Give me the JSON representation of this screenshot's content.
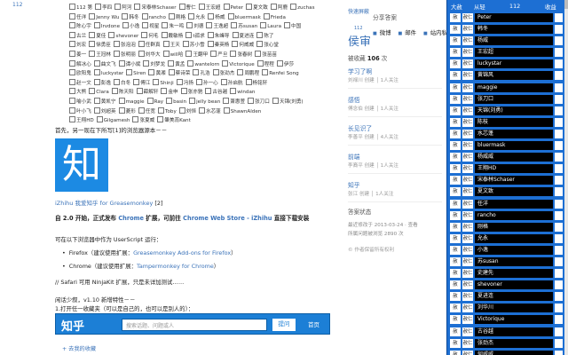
{
  "gutter": {
    "num": "112"
  },
  "checkbox_rows": [
    [
      {
        "l": "112 第",
        "c": false
      },
      {
        "l": "李四",
        "c": false
      },
      {
        "l": "阿河",
        "c": false
      },
      {
        "l": "宋泰林Schaser",
        "c": false
      },
      {
        "l": "曹仁",
        "c": false
      },
      {
        "l": "王宏超",
        "c": false
      },
      {
        "l": "Peter",
        "c": false
      },
      {
        "l": "夏文致",
        "c": false
      },
      {
        "l": "阿鹿",
        "c": false
      },
      {
        "l": "zuchas",
        "c": false
      }
    ],
    [
      {
        "l": "任洋",
        "c": false
      },
      {
        "l": "Jenny Wu",
        "c": false
      },
      {
        "l": "韩冬",
        "c": false
      },
      {
        "l": "rancho",
        "c": false
      },
      {
        "l": "刚格",
        "c": false
      },
      {
        "l": "允永",
        "c": false
      },
      {
        "l": "杨威",
        "c": false
      },
      {
        "l": "bluermask",
        "c": false
      },
      {
        "l": "Frieda",
        "c": false
      }
    ],
    [
      {
        "l": "陈心宇",
        "c": false
      },
      {
        "l": "Irvdone",
        "c": false
      },
      {
        "l": "小逸",
        "c": false
      },
      {
        "l": "视星",
        "c": false
      },
      {
        "l": "朱一鸣",
        "c": false
      },
      {
        "l": "刘德",
        "c": false
      },
      {
        "l": "王逸超",
        "c": false
      },
      {
        "l": "苏susan",
        "c": false
      },
      {
        "l": "Laura",
        "c": false
      },
      {
        "l": "中国",
        "c": false
      }
    ],
    [
      {
        "l": "古兰",
        "c": false
      },
      {
        "l": "夏佳",
        "c": false
      },
      {
        "l": "shevoner",
        "c": false
      },
      {
        "l": "何毛",
        "c": false
      },
      {
        "l": "戴敏杨",
        "c": false
      },
      {
        "l": "t孤求",
        "c": false
      },
      {
        "l": "朱峰导",
        "c": false
      },
      {
        "l": "夏进连",
        "c": false
      },
      {
        "l": "陈了",
        "c": false
      }
    ],
    [
      {
        "l": "刘宏",
        "c": false
      },
      {
        "l": "徐勇臣",
        "c": false
      },
      {
        "l": "张泡泡",
        "c": false
      },
      {
        "l": "任群真",
        "c": false
      },
      {
        "l": "王天",
        "c": false
      },
      {
        "l": "苏小雪",
        "c": false
      },
      {
        "l": "秦英杨",
        "c": false
      },
      {
        "l": "何威威",
        "c": false
      },
      {
        "l": "张心堂",
        "c": false
      }
    ],
    [
      {
        "l": "姜一",
        "c": false
      },
      {
        "l": "王冠林",
        "c": false
      },
      {
        "l": "张明丽",
        "c": false
      },
      {
        "l": "刘华大",
        "c": false
      },
      {
        "l": "will哈",
        "c": false
      },
      {
        "l": "王翻甲",
        "c": false
      },
      {
        "l": "严旦",
        "c": false
      },
      {
        "l": "张春树",
        "c": false
      },
      {
        "l": "张苗苗",
        "c": false
      }
    ],
    [
      {
        "l": "解冰心",
        "c": false
      },
      {
        "l": "曲文飞",
        "c": false
      },
      {
        "l": "谭小斌",
        "c": false
      },
      {
        "l": "刘梦龙",
        "c": false
      },
      {
        "l": "黄孟",
        "c": false
      },
      {
        "l": "wantelorn",
        "c": false
      },
      {
        "l": "Victorique",
        "c": false
      },
      {
        "l": "程程",
        "c": false
      },
      {
        "l": "伊莎",
        "c": false
      }
    ],
    [
      {
        "l": "欧阳鬼",
        "c": false
      },
      {
        "l": "luckystar",
        "c": false
      },
      {
        "l": "Siren",
        "c": false
      },
      {
        "l": "黄湘",
        "c": false
      },
      {
        "l": "蔡诗荣",
        "c": false
      },
      {
        "l": "孔浩",
        "c": false
      },
      {
        "l": "张劲杰",
        "c": false
      },
      {
        "l": "周鹏程",
        "c": false
      },
      {
        "l": "Renfei Song",
        "c": false
      }
    ],
    [
      {
        "l": "赵一文",
        "c": false
      },
      {
        "l": "彭逸",
        "c": false
      },
      {
        "l": "白冬",
        "c": false
      },
      {
        "l": "傅江",
        "c": false
      },
      {
        "l": "Shinji",
        "c": false
      },
      {
        "l": "冯扬",
        "c": false
      },
      {
        "l": "孙一心",
        "c": false
      },
      {
        "l": "孙启航",
        "c": false
      },
      {
        "l": "杨铭轩",
        "c": false
      }
    ],
    [
      {
        "l": "大熊",
        "c": false
      },
      {
        "l": "Clara",
        "c": false
      },
      {
        "l": "陈天阳",
        "c": false
      },
      {
        "l": "薛解轩",
        "c": false
      },
      {
        "l": "金申",
        "c": false
      },
      {
        "l": "张亦驰",
        "c": false
      },
      {
        "l": "古谷越",
        "c": false
      },
      {
        "l": "windan",
        "c": false
      }
    ],
    [
      {
        "l": "喻小武",
        "c": false
      },
      {
        "l": "黄凯宁",
        "c": false
      },
      {
        "l": "maggie",
        "c": false
      },
      {
        "l": "Ray",
        "c": false
      },
      {
        "l": "basin",
        "c": false
      },
      {
        "l": "jelly bean",
        "c": false
      },
      {
        "l": "萧惠萱",
        "c": false
      },
      {
        "l": "张刀口",
        "c": false
      },
      {
        "l": "天锦(刘勇)",
        "c": false
      }
    ],
    [
      {
        "l": "叶小飞",
        "c": false
      },
      {
        "l": "刘超英",
        "c": false
      },
      {
        "l": "菱形",
        "c": false
      },
      {
        "l": "任宽",
        "c": false
      },
      {
        "l": "Toby",
        "c": false
      },
      {
        "l": "刘恒",
        "c": false
      },
      {
        "l": "水芯蓬",
        "c": false
      },
      {
        "l": "ShawnAlden",
        "c": false
      }
    ],
    [
      {
        "l": "王翔HD",
        "c": false
      },
      {
        "l": "Gilgamesh",
        "c": false
      },
      {
        "l": "张夏威",
        "c": false
      },
      {
        "l": "肇美蕊Kant",
        "c": false
      }
    ]
  ],
  "intro": "首先，另一现在下所写[1]的浏览器源本－－",
  "logo_char": "知",
  "logo_caption": {
    "link": "iZhihu 我爱知乎 for Greasemonkey",
    "ref": "[2]"
  },
  "para1": {
    "pre": "自 2.0 开始，正式发布 ",
    "chrome": "Chrome",
    "mid": " 扩展，可前往 ",
    "store": "Chrome Web Store - iZhihu",
    "post": " 直接下载安装"
  },
  "para2": "可在以下浏览器中作为 UserScript 运行：",
  "bullets": [
    {
      "pre": "Firefox（建议使用扩展：",
      "link": "Greasemonkey",
      "sep": " Add-ons for Firefox",
      "post": "）"
    },
    {
      "pre": "Chrome（建议使用扩展：",
      "link": "Tampermonkey for Chrome",
      "sep": "",
      "post": "）"
    }
  ],
  "para3": "// Safari 可用 NinjaKit 扩展，只是未详加测试……",
  "para4a": "闲话少叙，v1.10 新增特性－－",
  "para4b": "1.打开任一收藏夹（可以是自己的，也可以是别人的）：",
  "zhihu_bar": {
    "brand": "知乎",
    "search_placeholder": "搜索话题、问题或人",
    "ask": "提问",
    "home": "首页"
  },
  "collect_link": "+ 去我的收藏",
  "sidebar": {
    "quickfill": "快速屏蔽",
    "share_header": "分享答案",
    "hot_pop": "侯审",
    "hot_pop_num": "112",
    "share_links": [
      "微博",
      "邮件",
      "站内私信"
    ],
    "fav_count_label": "被收藏",
    "fav_count": "106",
    "fav_count_unit": "次",
    "collections": [
      {
        "name": "学习了啊",
        "meta": "刘禄川 创建 │ 1人关注"
      },
      {
        "name": "感悟",
        "meta": "傅念伯 创建 │ 1人关注"
      },
      {
        "name": "长见识了",
        "meta": "李善平 创建 │ 4人关注"
      },
      {
        "name": "前端",
        "meta": "李裔平 创建 │ 1人关注"
      },
      {
        "name": "知乎",
        "meta": "张江 创建 │ 1人关注"
      }
    ],
    "status_header": "答案状态",
    "status_lines": [
      "最近修改于 2013-03-24 · 查看",
      "所属问题被浏览 2890 次"
    ],
    "report": "© 作者保留所有权利"
  },
  "panel": {
    "headers": [
      "大赦",
      "从轻",
      "112",
      "收益"
    ],
    "rows": [
      {
        "a": "赦",
        "b": "赦仁",
        "name": "Peter"
      },
      {
        "a": "赦",
        "b": "赦仁",
        "name": "韩冬"
      },
      {
        "a": "赦",
        "b": "赦仁",
        "name": "杨威"
      },
      {
        "a": "赦",
        "b": "赦仁",
        "name": "王宏超"
      },
      {
        "a": "赦",
        "b": "赦仁",
        "name": "luckystar"
      },
      {
        "a": "赦",
        "b": "赦仁",
        "name": "黄锦风"
      },
      {
        "a": "赦",
        "b": "赦仁",
        "name": "maggie"
      },
      {
        "a": "赦",
        "b": "赦仁",
        "name": "张刀口"
      },
      {
        "a": "赦",
        "b": "赦仁",
        "name": "天锦(刘勇)"
      },
      {
        "a": "赦",
        "b": "赦仁",
        "name": "陈枝"
      },
      {
        "a": "赦",
        "b": "赦仁",
        "name": "水芯蓬"
      },
      {
        "a": "赦",
        "b": "赦仁",
        "name": "bluermask"
      },
      {
        "a": "赦",
        "b": "赦仁",
        "name": "杨威威"
      },
      {
        "a": "赦",
        "b": "赦仁",
        "name": "王翔HD"
      },
      {
        "a": "赦",
        "b": "赦仁",
        "name": "宋泰林Schaser"
      },
      {
        "a": "赦",
        "b": "赦仁",
        "name": "夏文致"
      },
      {
        "a": "赦",
        "b": "赦仁",
        "name": "任洋"
      },
      {
        "a": "赦",
        "b": "赦仁",
        "name": "rancho"
      },
      {
        "a": "赦",
        "b": "赦仁",
        "name": "刚格"
      },
      {
        "a": "赦",
        "b": "赦仁",
        "name": "允永"
      },
      {
        "a": "赦",
        "b": "赦仁",
        "name": "小逸"
      },
      {
        "a": "赦",
        "b": "赦仁",
        "name": "苏susan"
      },
      {
        "a": "赦",
        "b": "赦仁",
        "name": "史建先"
      },
      {
        "a": "赦",
        "b": "赦仁",
        "name": "shevoner"
      },
      {
        "a": "赦",
        "b": "赦仁",
        "name": "夏进连"
      },
      {
        "a": "赦",
        "b": "赦仁",
        "name": "刘华川"
      },
      {
        "a": "赦",
        "b": "赦仁",
        "name": "Victorique"
      },
      {
        "a": "赦",
        "b": "赦仁",
        "name": "古谷越"
      },
      {
        "a": "赦",
        "b": "赦仁",
        "name": "张劲杰"
      },
      {
        "a": "赦",
        "b": "赦仁",
        "name": "何威威"
      }
    ]
  },
  "colors": {
    "accent": "#3b73b9",
    "panel": "#1d6fd3",
    "zhihu": "#1c7fd6"
  }
}
